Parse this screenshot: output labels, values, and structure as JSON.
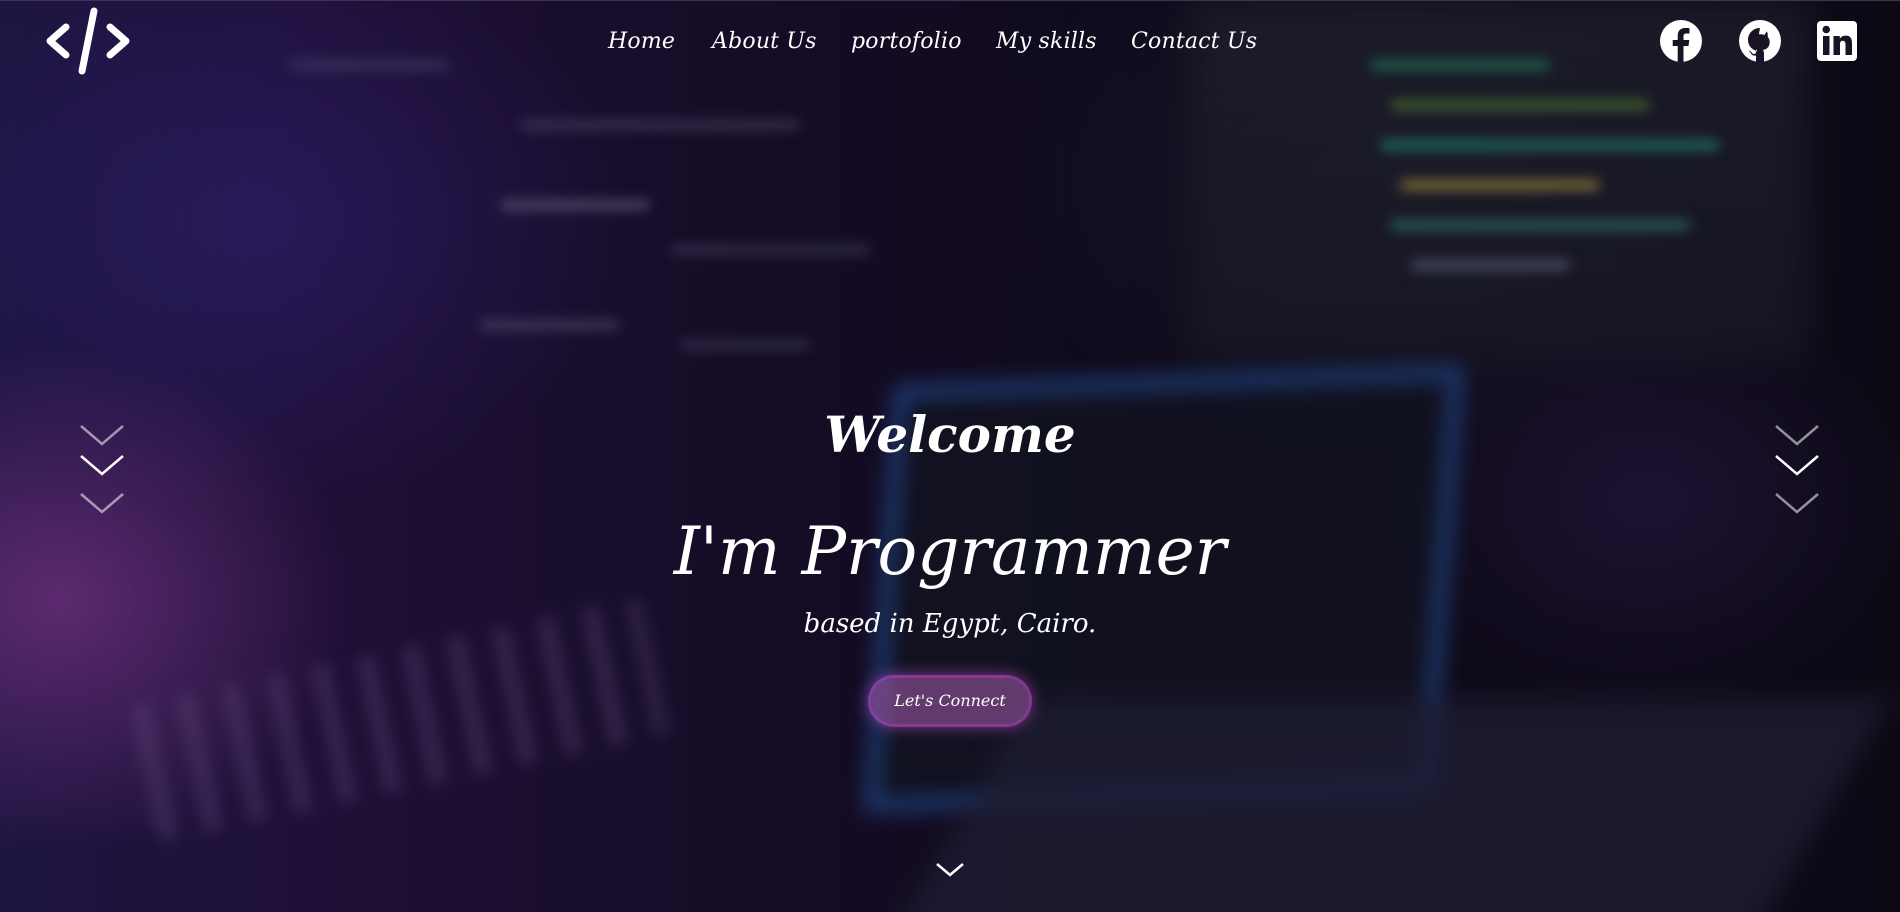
{
  "header": {
    "logo_icon": "code-brackets-icon",
    "nav": [
      {
        "label": "Home"
      },
      {
        "label": "About Us"
      },
      {
        "label": "portofolio"
      },
      {
        "label": "My skills"
      },
      {
        "label": "Contact Us"
      }
    ],
    "social": [
      {
        "icon": "facebook-icon"
      },
      {
        "icon": "github-icon"
      },
      {
        "icon": "linkedin-icon"
      }
    ]
  },
  "hero": {
    "welcome": "Welcome",
    "title": "I'm Programmer",
    "subtitle": "based in Egypt, Cairo.",
    "cta_label": "Let's Connect"
  },
  "decor": {
    "side_icons": "chevron-down-icon",
    "scroll_icon": "chevron-down-icon",
    "accent_color": "#c850d2",
    "text_color": "#ffffff"
  }
}
